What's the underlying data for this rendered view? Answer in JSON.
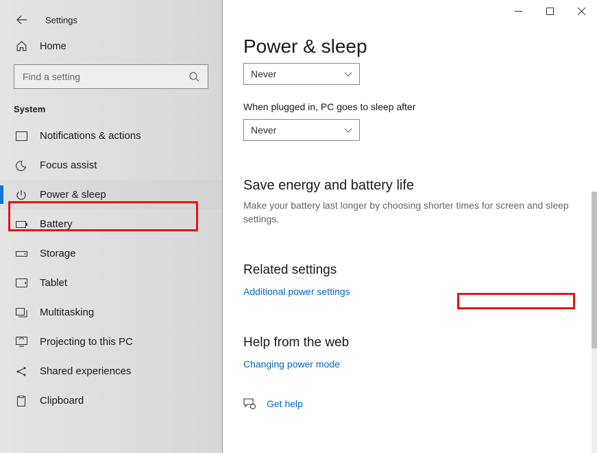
{
  "window": {
    "title": "Settings"
  },
  "sidebar": {
    "home": "Home",
    "searchPlaceholder": "Find a setting",
    "category": "System",
    "items": [
      {
        "id": "notifications",
        "label": "Notifications & actions"
      },
      {
        "id": "focus-assist",
        "label": "Focus assist"
      },
      {
        "id": "power-sleep",
        "label": "Power & sleep",
        "active": true
      },
      {
        "id": "battery",
        "label": "Battery"
      },
      {
        "id": "storage",
        "label": "Storage"
      },
      {
        "id": "tablet",
        "label": "Tablet"
      },
      {
        "id": "multitasking",
        "label": "Multitasking"
      },
      {
        "id": "projecting",
        "label": "Projecting to this PC"
      },
      {
        "id": "shared",
        "label": "Shared experiences"
      },
      {
        "id": "clipboard",
        "label": "Clipboard"
      }
    ]
  },
  "main": {
    "heading": "Power & sleep",
    "dropdown1": "Never",
    "sleepLabel": "When plugged in, PC goes to sleep after",
    "dropdown2": "Never",
    "section1": {
      "title": "Save energy and battery life",
      "desc": "Make your battery last longer by choosing shorter times for screen and sleep settings."
    },
    "section2": {
      "title": "Related settings",
      "link": "Additional power settings"
    },
    "section3": {
      "title": "Help from the web",
      "link": "Changing power mode"
    },
    "getHelp": "Get help"
  }
}
